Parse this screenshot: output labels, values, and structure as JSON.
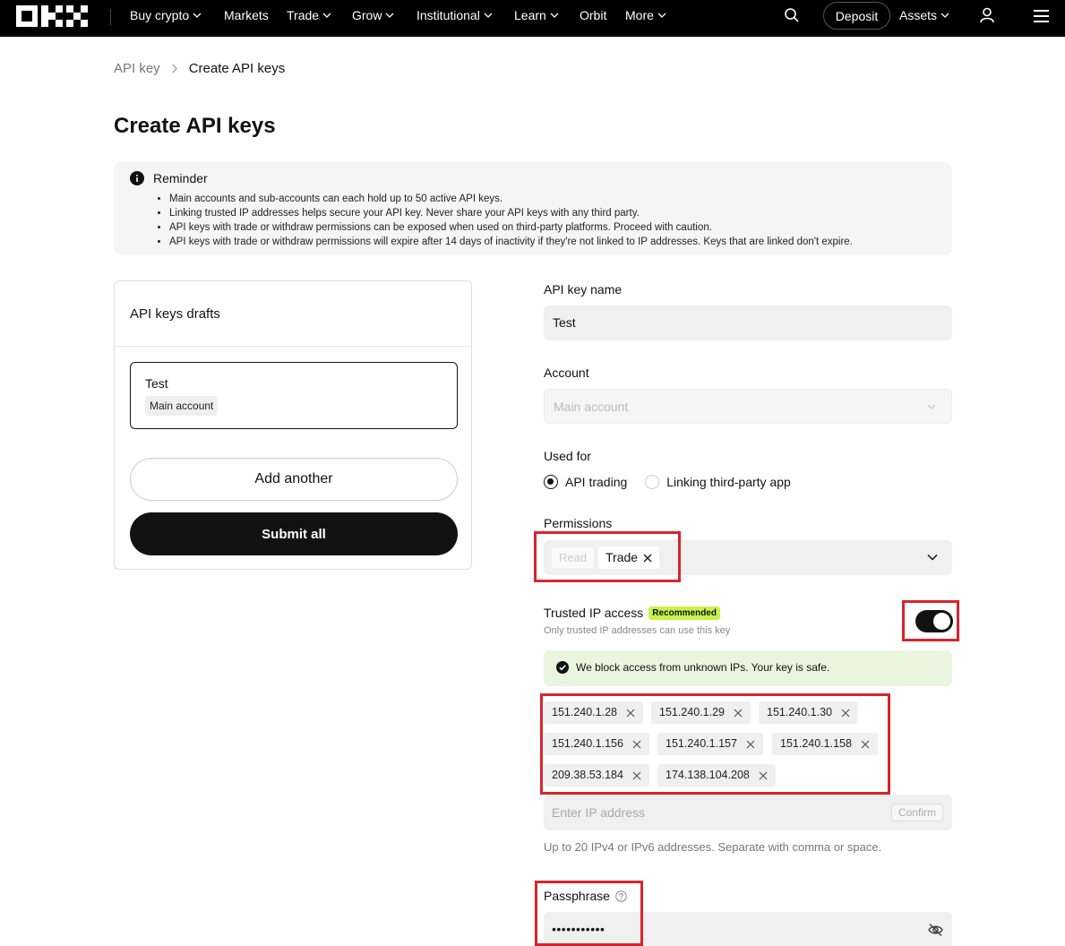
{
  "nav": {
    "items": [
      {
        "label": "Buy crypto",
        "dropdown": true
      },
      {
        "label": "Markets",
        "dropdown": false
      },
      {
        "label": "Trade",
        "dropdown": true
      },
      {
        "label": "Grow",
        "dropdown": true
      },
      {
        "label": "Institutional",
        "dropdown": true
      },
      {
        "label": "Learn",
        "dropdown": true
      },
      {
        "label": "Orbit",
        "dropdown": false
      },
      {
        "label": "More",
        "dropdown": true
      }
    ],
    "deposit": "Deposit",
    "assets": "Assets",
    "icons": [
      "okx-logo",
      "search-icon",
      "user-icon",
      "menu-icon"
    ]
  },
  "breadcrumb": {
    "parent": "API key",
    "current": "Create API keys"
  },
  "page_title": "Create API keys",
  "reminder": {
    "title": "Reminder",
    "items": [
      "Main accounts and sub-accounts can each hold up to 50 active API keys.",
      "Linking trusted IP addresses helps secure your API key. Never share your API keys with any third party.",
      "API keys with trade or withdraw permissions can be exposed when used on third-party platforms. Proceed with caution.",
      "API keys with trade or withdraw permissions will expire after 14 days of inactivity if they're not linked to IP addresses. Keys that are linked don't expire."
    ]
  },
  "drafts": {
    "title": "API keys drafts",
    "item": {
      "name": "Test",
      "account": "Main account"
    },
    "add_label": "Add another",
    "submit_label": "Submit all"
  },
  "form": {
    "name_label": "API key name",
    "name_value": "Test",
    "account_label": "Account",
    "account_value": "Main account",
    "used_for_label": "Used for",
    "used_for_options": [
      "API trading",
      "Linking third-party app"
    ],
    "used_for_selected": "API trading",
    "permissions_label": "Permissions",
    "permissions": {
      "read": "Read",
      "trade": "Trade"
    },
    "trusted_label": "Trusted IP access",
    "trusted_badge": "Recommended",
    "trusted_sub": "Only trusted IP addresses can use this key",
    "trusted_enabled": true,
    "notice": "We block access from unknown IPs. Your key is safe.",
    "ips": [
      "151.240.1.28",
      "151.240.1.29",
      "151.240.1.30",
      "151.240.1.156",
      "151.240.1.157",
      "151.240.1.158",
      "209.38.53.184",
      "174.138.104.208"
    ],
    "ip_placeholder": "Enter IP address",
    "confirm_label": "Confirm",
    "ip_help": "Up to 20 IPv4 or IPv6 addresses. Separate with comma or space.",
    "passphrase_label": "Passphrase",
    "passphrase_masked": "•••••••••••"
  },
  "colors": {
    "accent": "#121212",
    "badge": "#c6f34a",
    "notice_bg": "#e9f5df",
    "highlight": "#d8242d"
  }
}
